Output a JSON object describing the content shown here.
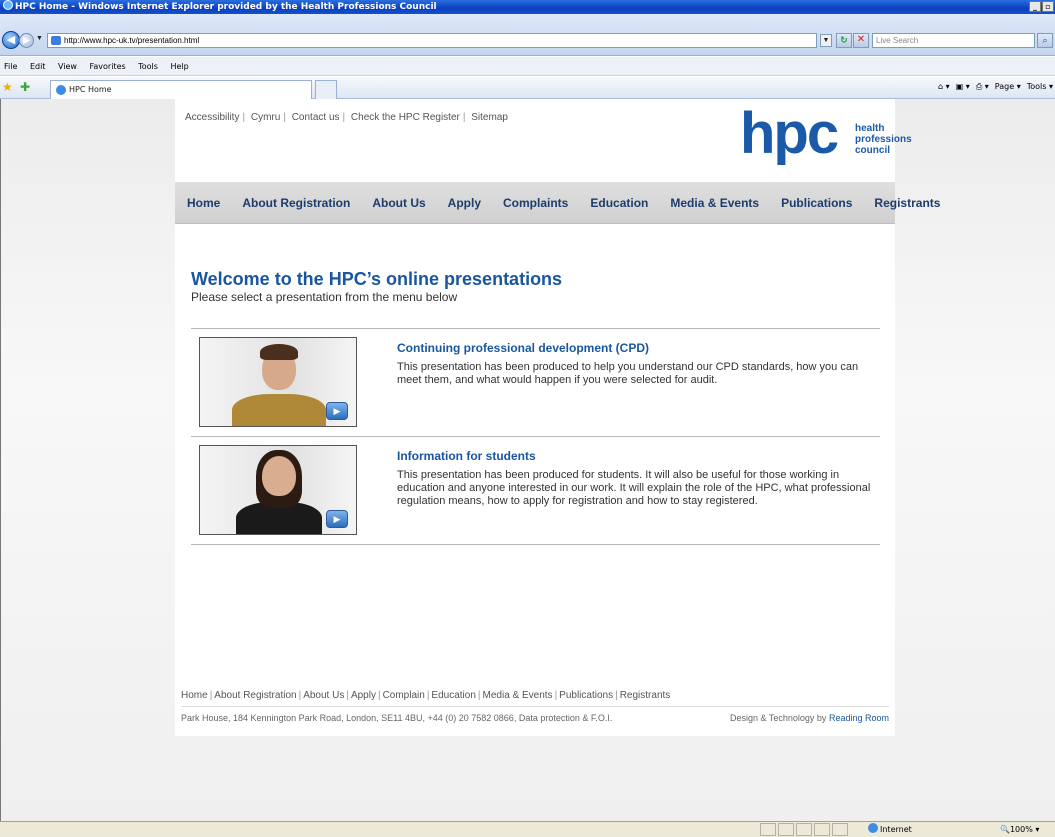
{
  "browser": {
    "window_title": "HPC Home - Windows Internet Explorer provided by the Health Professions Council",
    "url": "http://www.hpc-uk.tv/presentation.html",
    "search_placeholder": "Live Search",
    "menu": [
      "File",
      "Edit",
      "View",
      "Favorites",
      "Tools",
      "Help"
    ],
    "tab_title": "HPC Home",
    "command_bar": [
      "Page",
      "Tools"
    ],
    "status": {
      "zone": "Internet",
      "zoom": "100%"
    }
  },
  "site": {
    "util_links": [
      "Accessibility",
      "Cymru",
      "Contact us",
      "Check the HPC Register",
      "Sitemap"
    ],
    "logo": {
      "mark": "hpc",
      "line1": "health",
      "line2": "professions",
      "line3": "council"
    },
    "main_nav": [
      "Home",
      "About Registration",
      "About Us",
      "Apply",
      "Complaints",
      "Education",
      "Media & Events",
      "Publications",
      "Registrants"
    ],
    "heading": "Welcome to the HPC’s online presentations",
    "subheading": "Please select a presentation from the menu below",
    "presentations": [
      {
        "title": "Continuing professional development (CPD)",
        "description": "This presentation has been produced to help you understand our CPD standards, how you can meet them, and what would happen if you were selected for audit."
      },
      {
        "title": "Information for students",
        "description": "This presentation has been produced for students. It will also be useful for those working in education and anyone interested in our work. It will explain the role of the HPC, what professional regulation means, how to apply for registration and how to stay registered."
      }
    ],
    "footer_nav": [
      "Home",
      "About Registration",
      "About Us",
      "Apply",
      "Complain",
      "Education",
      "Media & Events",
      "Publications",
      "Registrants"
    ],
    "footer_address": "Park House, 184 Kennington Park Road, London, SE11 4BU, +44 (0) 20 7582 0866, Data protection & F.O.I.",
    "footer_credit_prefix": "Design & Technology by",
    "footer_credit_link": "Reading Room"
  }
}
